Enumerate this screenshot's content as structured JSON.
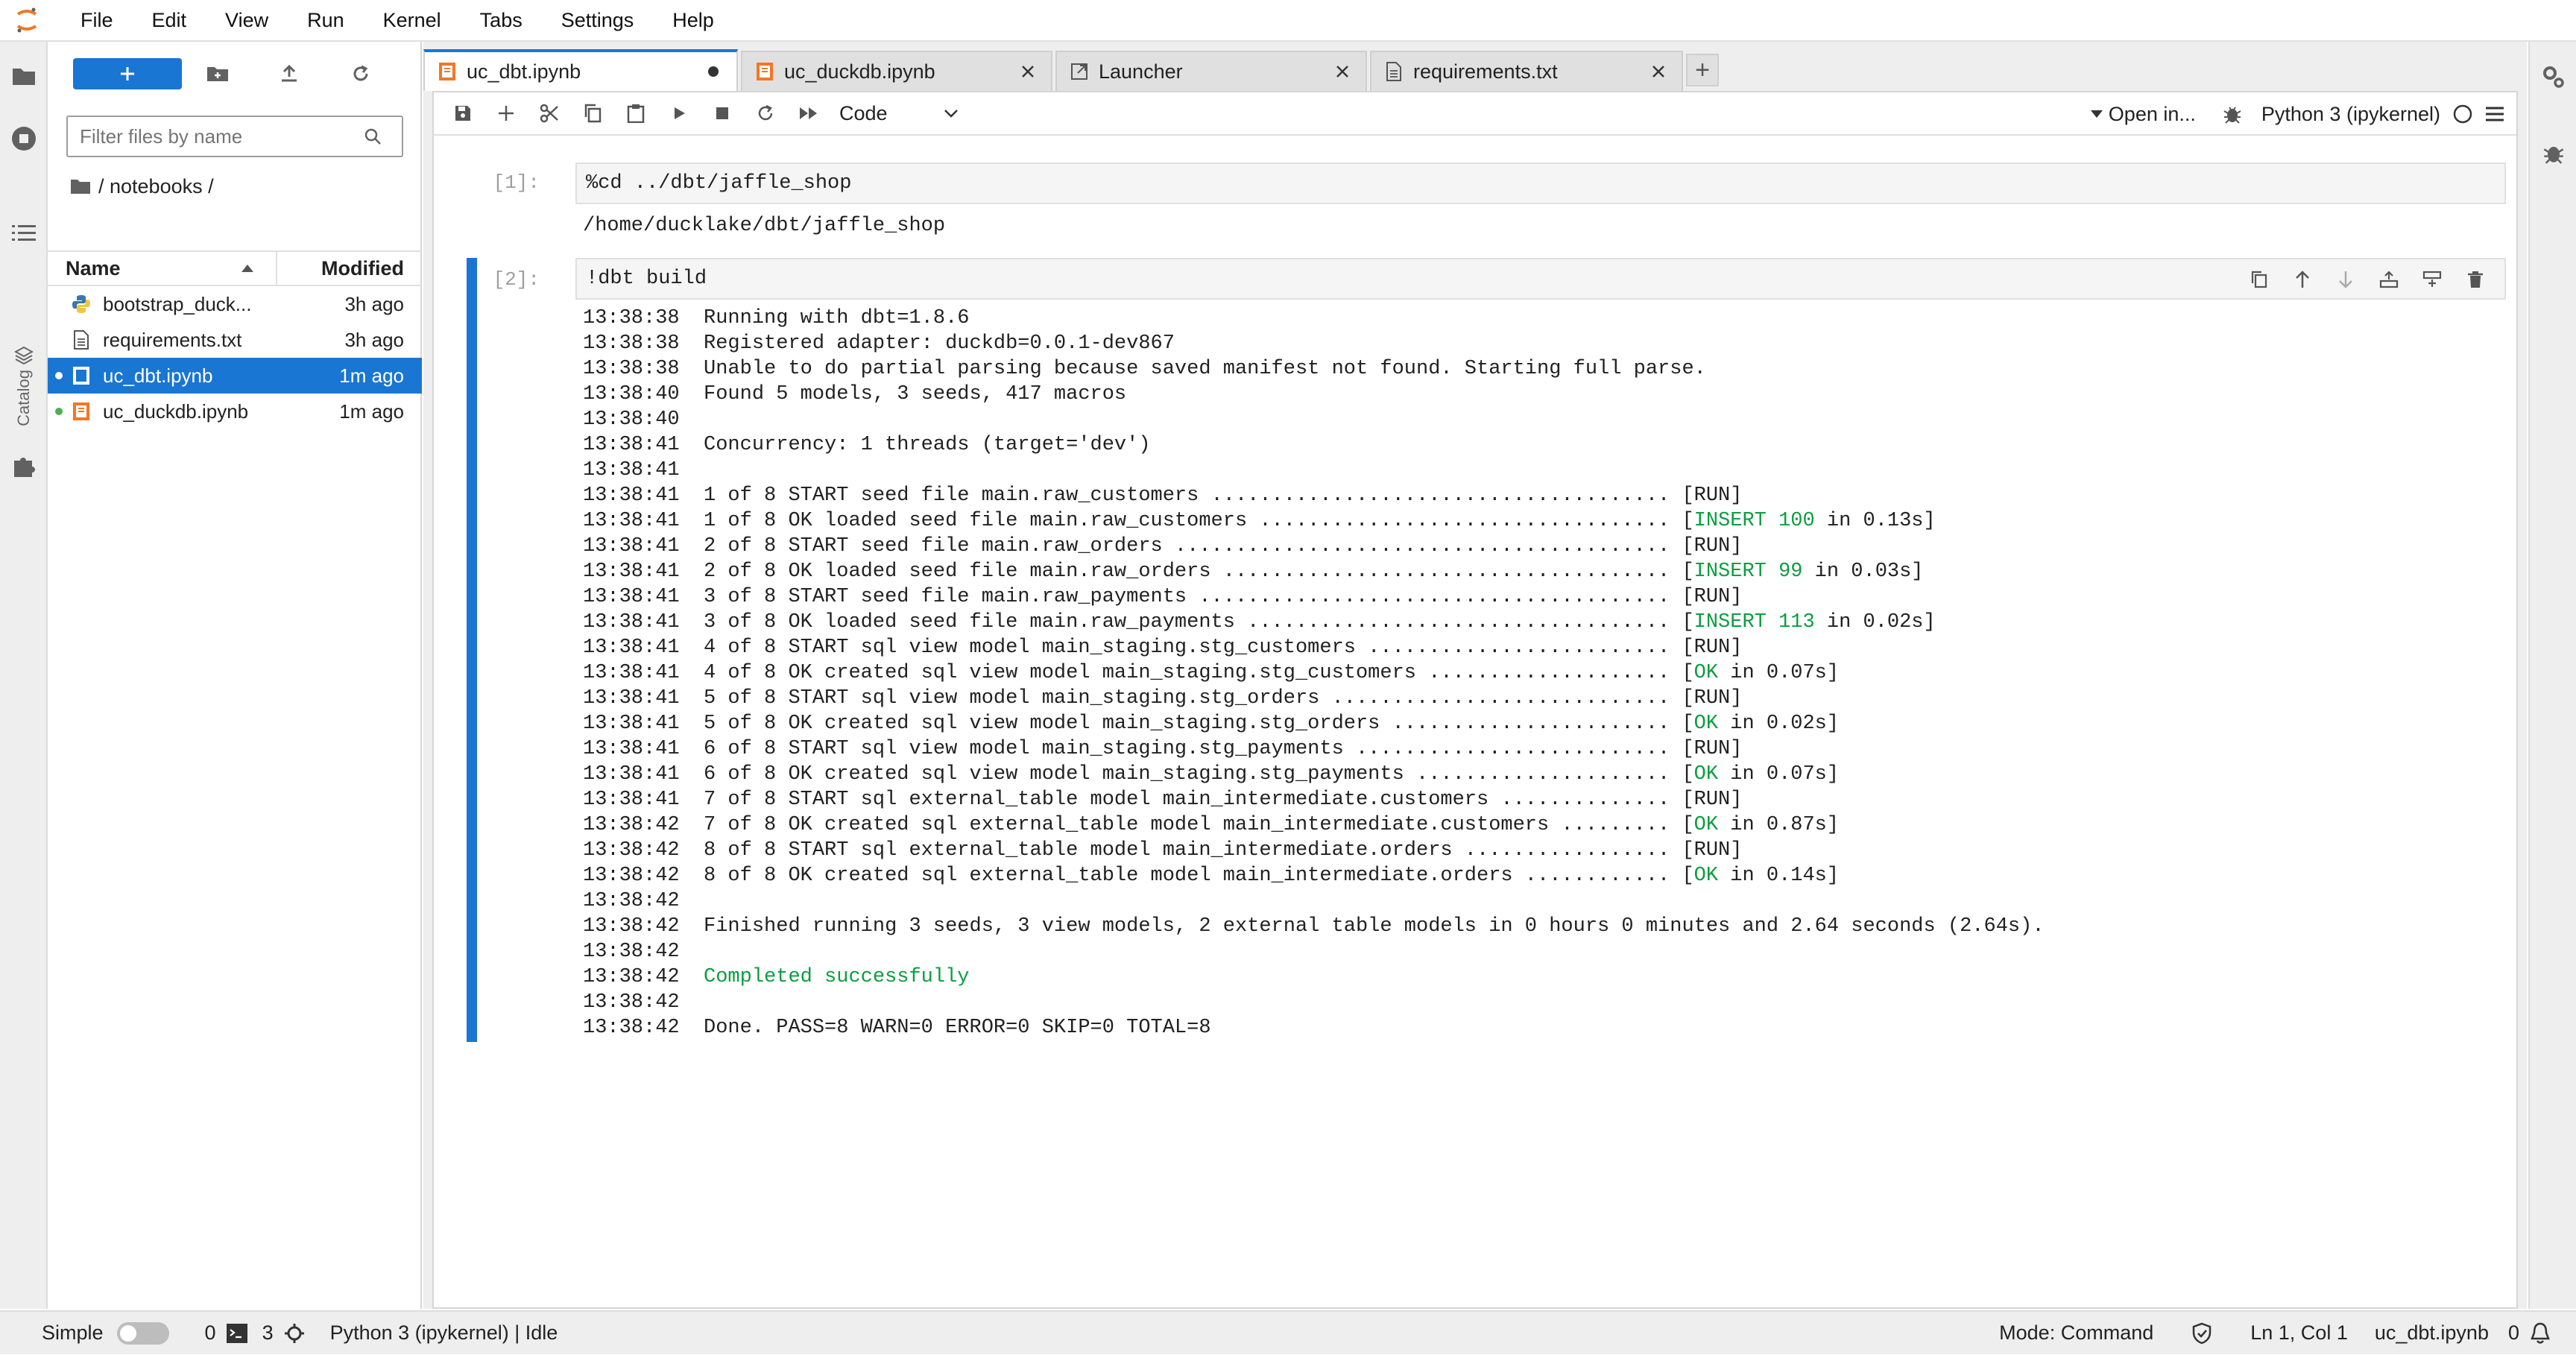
{
  "menu": [
    "File",
    "Edit",
    "View",
    "Run",
    "Kernel",
    "Tabs",
    "Settings",
    "Help"
  ],
  "sidebar": {
    "catalog_label": "Catalog"
  },
  "filebrowser": {
    "filter_placeholder": "Filter files by name",
    "breadcrumb": "/ notebooks /",
    "col_name": "Name",
    "col_modified": "Modified",
    "files": [
      {
        "name": "bootstrap_duckdb.ipynb",
        "display": "bootstrap_duck...",
        "modified": "3h ago",
        "icon": "python-icon",
        "running": false,
        "selected": false
      },
      {
        "name": "requirements.txt",
        "display": "requirements.txt",
        "modified": "3h ago",
        "icon": "text-file-icon",
        "running": false,
        "selected": false
      },
      {
        "name": "uc_dbt.ipynb",
        "display": "uc_dbt.ipynb",
        "modified": "1m ago",
        "icon": "notebook-icon",
        "running": true,
        "selected": true
      },
      {
        "name": "uc_duckdb.ipynb",
        "display": "uc_duckdb.ipynb",
        "modified": "1m ago",
        "icon": "notebook-icon",
        "running": true,
        "selected": false
      }
    ]
  },
  "tabs": [
    {
      "label": "uc_dbt.ipynb",
      "icon": "notebook-icon",
      "active": true,
      "dirty": true
    },
    {
      "label": "uc_duckdb.ipynb",
      "icon": "notebook-icon",
      "active": false,
      "dirty": false
    },
    {
      "label": "Launcher",
      "icon": "launcher-icon",
      "active": false,
      "dirty": false
    },
    {
      "label": "requirements.txt",
      "icon": "text-file-icon",
      "active": false,
      "dirty": false
    }
  ],
  "toolbar": {
    "cell_type": "Code",
    "open_in": "Open in...",
    "kernel": "Python 3 (ipykernel)"
  },
  "cells": [
    {
      "prompt": "[1]:",
      "source": "%cd ../dbt/jaffle_shop",
      "output": "/home/ducklake/dbt/jaffle_shop"
    },
    {
      "prompt": "[2]:",
      "source": "!dbt build"
    }
  ],
  "output_lines": [
    {
      "t": "13:38:38",
      "text": "Running with dbt=1.8.6"
    },
    {
      "t": "13:38:38",
      "text": "Registered adapter: duckdb=0.0.1-dev867"
    },
    {
      "t": "13:38:38",
      "text": "Unable to do partial parsing because saved manifest not found. Starting full parse."
    },
    {
      "t": "13:38:40",
      "text": "Found 5 models, 3 seeds, 417 macros"
    },
    {
      "t": "13:38:40",
      "text": ""
    },
    {
      "t": "13:38:41",
      "text": "Concurrency: 1 threads (target='dev')"
    },
    {
      "t": "13:38:41",
      "text": ""
    },
    {
      "t": "13:38:41",
      "text": "1 of 8 START seed file main.raw_customers ...................................... ",
      "status": "[RUN]"
    },
    {
      "t": "13:38:41",
      "text": "1 of 8 OK loaded seed file main.raw_customers .................................. ",
      "pre": "[",
      "green": "INSERT 100",
      "post": " in 0.13s]"
    },
    {
      "t": "13:38:41",
      "text": "2 of 8 START seed file main.raw_orders ......................................... ",
      "status": "[RUN]"
    },
    {
      "t": "13:38:41",
      "text": "2 of 8 OK loaded seed file main.raw_orders ..................................... ",
      "pre": "[",
      "green": "INSERT 99",
      "post": " in 0.03s]"
    },
    {
      "t": "13:38:41",
      "text": "3 of 8 START seed file main.raw_payments ....................................... ",
      "status": "[RUN]"
    },
    {
      "t": "13:38:41",
      "text": "3 of 8 OK loaded seed file main.raw_payments ................................... ",
      "pre": "[",
      "green": "INSERT 113",
      "post": " in 0.02s]"
    },
    {
      "t": "13:38:41",
      "text": "4 of 8 START sql view model main_staging.stg_customers ......................... ",
      "status": "[RUN]"
    },
    {
      "t": "13:38:41",
      "text": "4 of 8 OK created sql view model main_staging.stg_customers .................... ",
      "pre": "[",
      "green": "OK",
      "post": " in 0.07s]"
    },
    {
      "t": "13:38:41",
      "text": "5 of 8 START sql view model main_staging.stg_orders ............................ ",
      "status": "[RUN]"
    },
    {
      "t": "13:38:41",
      "text": "5 of 8 OK created sql view model main_staging.stg_orders ....................... ",
      "pre": "[",
      "green": "OK",
      "post": " in 0.02s]"
    },
    {
      "t": "13:38:41",
      "text": "6 of 8 START sql view model main_staging.stg_payments .......................... ",
      "status": "[RUN]"
    },
    {
      "t": "13:38:41",
      "text": "6 of 8 OK created sql view model main_staging.stg_payments ..................... ",
      "pre": "[",
      "green": "OK",
      "post": " in 0.07s]"
    },
    {
      "t": "13:38:41",
      "text": "7 of 8 START sql external_table model main_intermediate.customers .............. ",
      "status": "[RUN]"
    },
    {
      "t": "13:38:42",
      "text": "7 of 8 OK created sql external_table model main_intermediate.customers ......... ",
      "pre": "[",
      "green": "OK",
      "post": " in 0.87s]"
    },
    {
      "t": "13:38:42",
      "text": "8 of 8 START sql external_table model main_intermediate.orders ................. ",
      "status": "[RUN]"
    },
    {
      "t": "13:38:42",
      "text": "8 of 8 OK created sql external_table model main_intermediate.orders ............ ",
      "pre": "[",
      "green": "OK",
      "post": " in 0.14s]"
    },
    {
      "t": "13:38:42",
      "text": ""
    },
    {
      "t": "13:38:42",
      "text": "Finished running 3 seeds, 3 view models, 2 external table models in 0 hours 0 minutes and 2.64 seconds (2.64s)."
    },
    {
      "t": "13:38:42",
      "text": ""
    },
    {
      "t": "13:38:42",
      "text": "",
      "green_only": "Completed successfully"
    },
    {
      "t": "13:38:42",
      "text": ""
    },
    {
      "t": "13:38:42",
      "text": "Done. PASS=8 WARN=0 ERROR=0 SKIP=0 TOTAL=8"
    }
  ],
  "status": {
    "mode_label": "Simple",
    "terminals": "0",
    "kernels": "3",
    "kernel_status": "Python 3 (ipykernel) | Idle",
    "mode": "Mode: Command",
    "position": "Ln 1, Col 1",
    "file": "uc_dbt.ipynb",
    "notifications": "0"
  },
  "colors": {
    "accent": "#1976d2",
    "success": "#0a9e3f",
    "notebook_icon": "#f37726"
  }
}
